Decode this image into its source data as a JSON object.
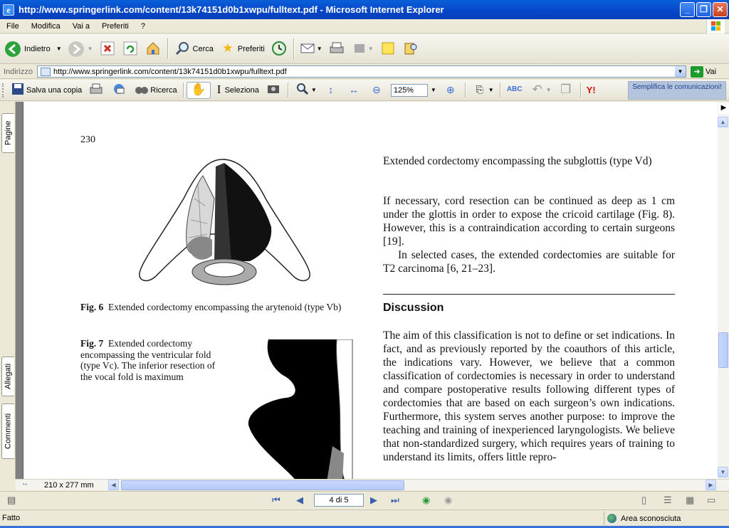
{
  "window": {
    "title": "http://www.springerlink.com/content/13k74151d0b1xwpu/fulltext.pdf - Microsoft Internet Explorer",
    "buttons": {
      "minimize": "_",
      "maximize": "❐",
      "close": "✕"
    }
  },
  "menubar": {
    "items": [
      "File",
      "Modifica",
      "Vai a",
      "Preferiti",
      "?"
    ]
  },
  "toolbar": {
    "back_label": "Indietro",
    "search_label": "Cerca",
    "favorites_label": "Preferiti"
  },
  "address": {
    "label": "Indirizzo",
    "url": "http://www.springerlink.com/content/13k74151d0b1xwpu/fulltext.pdf",
    "go_label": "Vai"
  },
  "acrobat": {
    "save_label": "Salva una copia",
    "search_label": "Ricerca",
    "select_label": "Seleziona",
    "zoom": "125%",
    "simplify_label": "Semplifica le comunicazioni!",
    "yahoo_label": "Y!"
  },
  "nav_tabs": {
    "pages": "Pagine",
    "attachments": "Allegati",
    "comments": "Commenti"
  },
  "document": {
    "page_number": "230",
    "right_heading": "Extended cordectomy encompassing the subglottis (type Vd)",
    "para1": "If necessary, cord resection can be continued as deep as 1 cm under the glottis in order to expose the cricoid cartilage (Fig. 8). However, this is a contraindication according to certain surgeons [19].",
    "para2": "In selected cases, the extended cordectomies are suitable for T2 carcinoma [6, 21–23].",
    "discussion_heading": "Discussion",
    "discussion_text": "The aim of this classification is not to define or set indications. In fact, and as previously reported by the coauthors of this article, the indications vary. However, we believe that a common classification of cordectomies is necessary in order to understand and compare postoperative results following different types of cordectomies that are based on each surgeon’s own indications. Furthermore, this system serves another purpose: to improve the teaching and training of inexperienced laryngologists. We believe that non-standardized surgery, which requires years of training to understand its limits, offers little repro-",
    "fig6_label": "Fig. 6",
    "fig6_caption": "Extended cordectomy encompassing the arytenoid (type Vb)",
    "fig7_label": "Fig. 7",
    "fig7_caption": "Extended cordectomy encompassing the ventricular fold (type Vc). The inferior resection of the vocal fold is maximum"
  },
  "page_size": "210 x 277 mm",
  "navigation": {
    "page_indicator": "4 di 5"
  },
  "status": {
    "text": "Fatto",
    "zone": "Area sconosciuta"
  }
}
